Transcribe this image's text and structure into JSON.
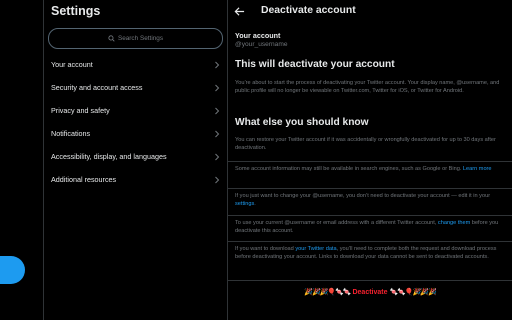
{
  "settings": {
    "title": "Settings",
    "search_placeholder": "Search Settings",
    "items": [
      {
        "label": "Your account"
      },
      {
        "label": "Security and account access"
      },
      {
        "label": "Privacy and safety"
      },
      {
        "label": "Notifications"
      },
      {
        "label": "Accessibility, display, and languages"
      },
      {
        "label": "Additional resources"
      }
    ]
  },
  "panel": {
    "title": "Deactivate account",
    "account_label": "Your account",
    "account_handle": "@your_username",
    "heading1": "This will deactivate your account",
    "para1": "You’re about to start the process of deactivating your Twitter account. Your display name, @username, and public profile will no longer be viewable on Twitter.com, Twitter for iOS, or Twitter for Android.",
    "heading2": "What else you should know",
    "para2": "You can restore your Twitter account if it was accidentally or wrongfully deactivated for up to 30 days after deactivation.",
    "note1_text": "Some account information may still be available in search engines, such as Google or Bing.",
    "note1_link": "Learn more",
    "note2_pre": "If you just want to change your @username, you don’t need to deactivate your account — edit it in your",
    "note2_link": "settings",
    "note2_post": ".",
    "note3_pre": "To use your current @username or email address with a different Twitter account,",
    "note3_link": "change them",
    "note3_post": "before you deactivate this account.",
    "note4_pre": "If you want to download",
    "note4_link": "your Twitter data",
    "note4_post": ", you’ll need to complete both the request and download process before deactivating your account. Links to download your data cannot be sent to deactivated accounts.",
    "deactivate_label": "Deactivate",
    "deactivate_deco_left": "🎉🎉🎉🎈🍬🍬",
    "deactivate_deco_right": "🍬🍬🎈🎉🎉🎉"
  },
  "colors": {
    "accent": "#1d9bf0",
    "danger": "#f4212e",
    "muted": "#71767b",
    "text": "#e7e9ea",
    "border": "#2f3336"
  }
}
